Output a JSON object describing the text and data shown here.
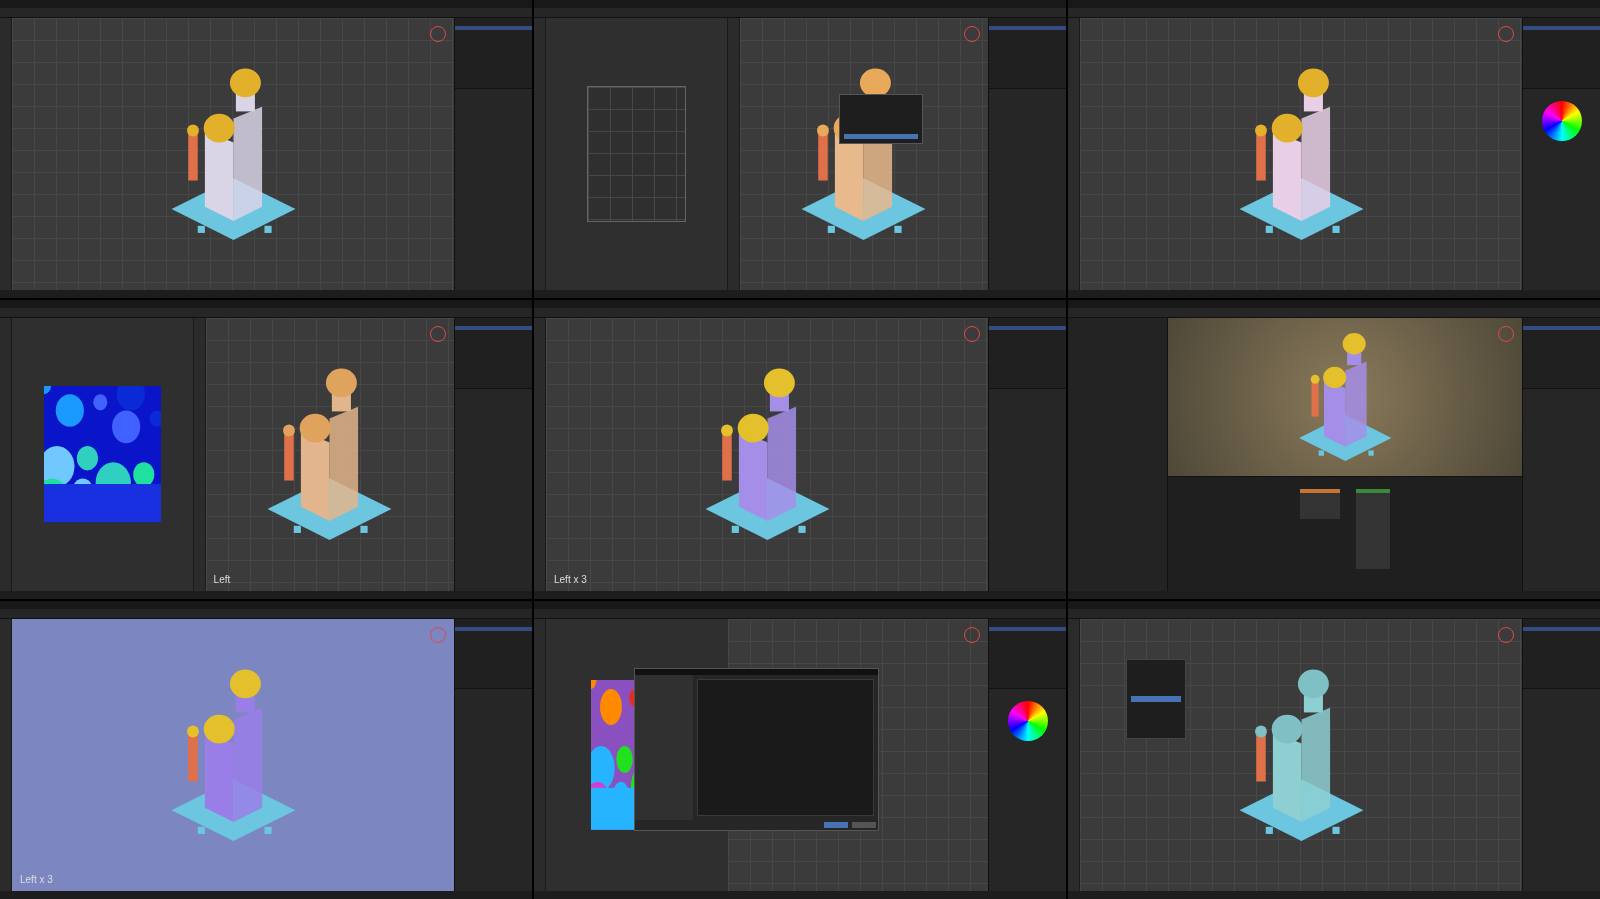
{
  "cells": [
    {
      "kind": "viewport",
      "parts": [
        {
          "kind": "body",
          "color": "#d9d4e6"
        },
        {
          "kind": "dome",
          "color": "#e3b02c"
        }
      ]
    },
    {
      "kind": "uv-split",
      "parts": [
        {
          "kind": "body",
          "color": "#e7b98c"
        },
        {
          "kind": "dome",
          "color": "#e9a95a"
        }
      ]
    },
    {
      "kind": "viewport",
      "color_wheel": true,
      "parts": [
        {
          "kind": "body",
          "color": "#e8cfe6"
        },
        {
          "kind": "dome",
          "color": "#e3b02c"
        }
      ]
    },
    {
      "kind": "texture-split",
      "label": "Left",
      "parts": [
        {
          "kind": "body",
          "color": "#e2b58c"
        },
        {
          "kind": "dome",
          "color": "#e0a35e"
        }
      ]
    },
    {
      "kind": "viewport",
      "label": "Left x 3",
      "parts": [
        {
          "kind": "body",
          "color": "#a48ee8"
        },
        {
          "kind": "dome",
          "color": "#e3c02c"
        }
      ]
    },
    {
      "kind": "render",
      "parts": [
        {
          "kind": "body",
          "color": "#a48ee8"
        },
        {
          "kind": "dome",
          "color": "#e3c02c"
        }
      ]
    },
    {
      "kind": "flat-view",
      "label": "Left x 3",
      "parts": [
        {
          "kind": "body",
          "color": "#9a7ee8"
        },
        {
          "kind": "dome",
          "color": "#e3c02c"
        }
      ]
    },
    {
      "kind": "paint-dialog",
      "color_wheel": true
    },
    {
      "kind": "menu",
      "parts": [
        {
          "kind": "body",
          "color": "#8ecfd2"
        },
        {
          "kind": "dome",
          "color": "#7fc0c4"
        }
      ]
    }
  ]
}
